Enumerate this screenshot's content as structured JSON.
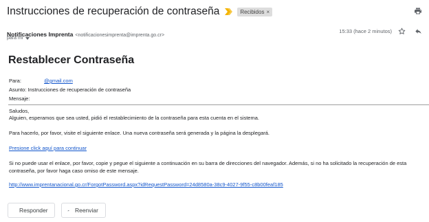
{
  "header": {
    "subject": "Instrucciones de recuperación de contraseña",
    "label": "Recibidos",
    "label_remove": "×",
    "icons": {
      "importance": "importance-marker-icon",
      "print": "print-icon"
    }
  },
  "sender": {
    "name": "Notificaciones Imprenta",
    "email": "<notificacionesimprenta@imprenta.go.cr>",
    "to": "para mí",
    "time": "15:33 (hace 2 minutos)",
    "icons": {
      "star": "star-icon",
      "reply": "reply-icon",
      "caret": "chevron-down-icon"
    }
  },
  "message": {
    "title": "Restablecer Contraseña",
    "para_label": "Para:",
    "para_value": "@gmail.com",
    "asunto": "Asunto: Instrucciones de recuperación de contraseña",
    "mensaje_label": "Mensaje:",
    "greeting": "Saludos,",
    "intro": "Alguien, esperamos que sea usted, pidió el restablecimiento de la contraseña para esta cuenta en el sistema.",
    "visit": "Para hacerlo, por favor, visite el siguiente enlace. Una nueva contraseña será generada y la página la desplegará.",
    "link_text": "Presione click aquí para continuar",
    "fallback": "Si no puede usar el enlace, por favor, copie y pegue el siguiente a continuación en su barra de direcciones del navegador. Además, si no ha solicitado la recuperación de esta contraseña, por favor haga caso omiso de este mensaje.",
    "url": "http://www.imprentanacional.go.cr/ForgotPassword.aspx?idRequestPassword=24d8580a-38c9-4027-9f55-c8b00feaf185"
  },
  "actions": {
    "reply_label": "Responder",
    "forward_label": "Reenviar",
    "icons": {
      "reply": "reply-icon",
      "forward": "forward-icon"
    }
  },
  "colors": {
    "link": "#1155cc",
    "importance": "#f4b400",
    "chip": "#dddddd"
  }
}
